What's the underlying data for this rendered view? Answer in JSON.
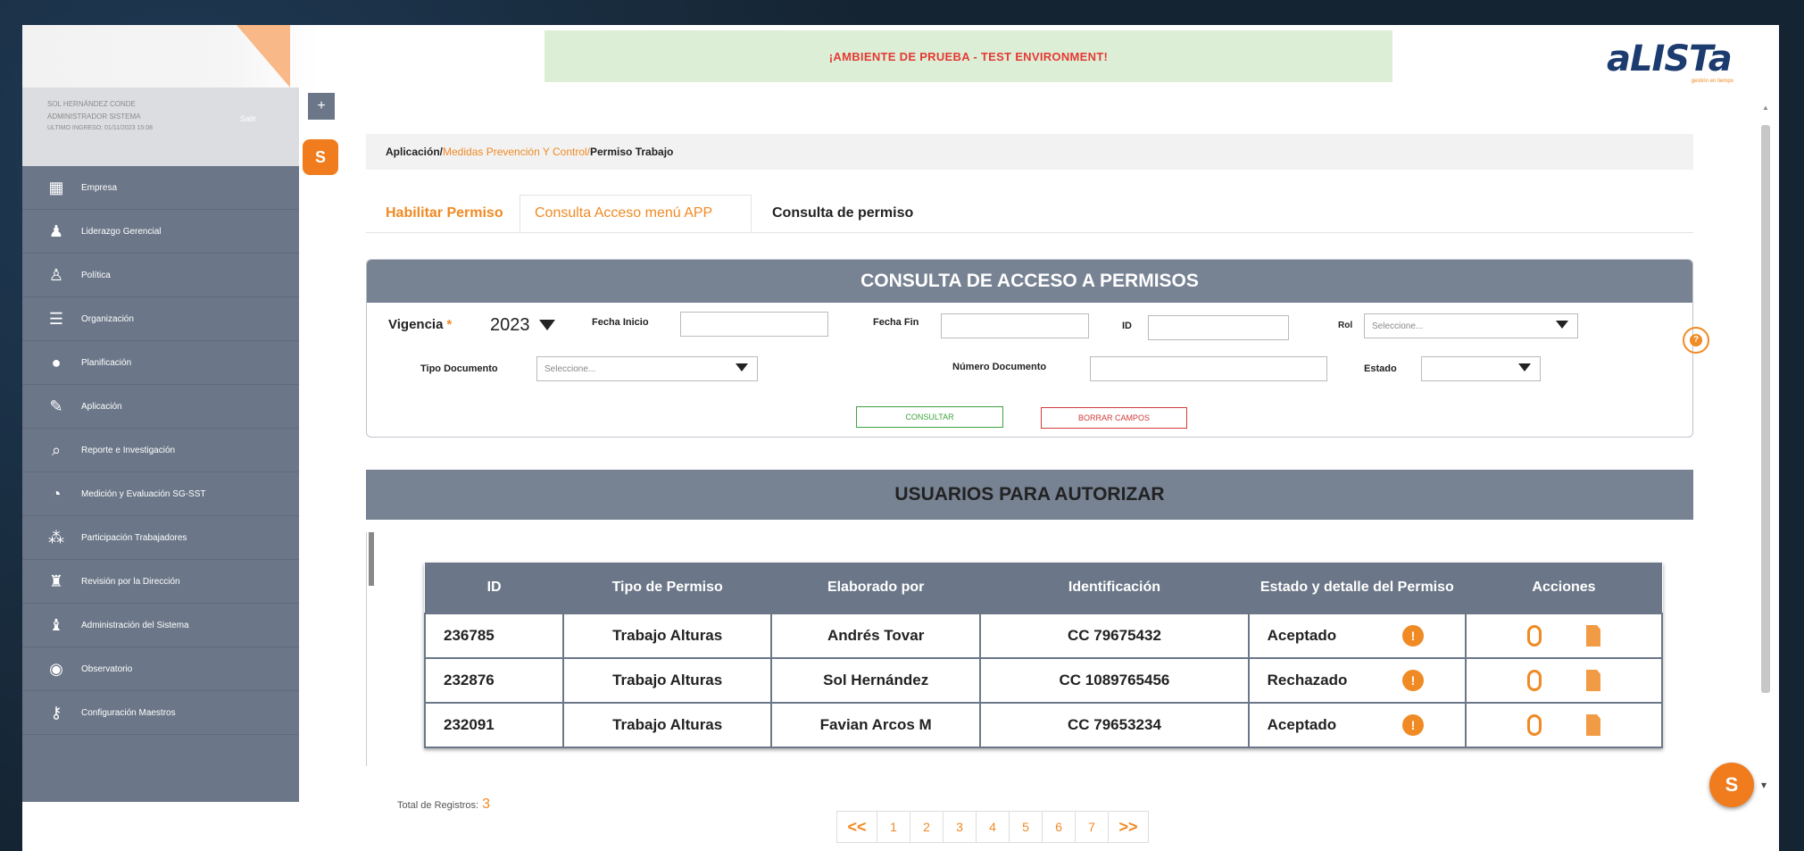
{
  "env_banner": "¡AMBIENTE DE PRUEBA - TEST ENVIRONMENT!",
  "logo": {
    "text": "aLISTa",
    "sub": "gestión en tiempo"
  },
  "user": {
    "name": "SOL HERNÁNDEZ CONDE",
    "role": "ADMINISTRADOR SISTEMA",
    "last_login": "ULTIMO INGRESO: 01/11/2023 15:08",
    "logout": "Salir"
  },
  "sidebar": {
    "items": [
      {
        "label": "Empresa",
        "icon": "building-icon"
      },
      {
        "label": "Liderazgo Gerencial",
        "icon": "team-icon"
      },
      {
        "label": "Política",
        "icon": "person-icon"
      },
      {
        "label": "Organización",
        "icon": "list-icon"
      },
      {
        "label": "Planificación",
        "icon": "lightbulb-icon"
      },
      {
        "label": "Aplicación",
        "icon": "pencil-icon"
      },
      {
        "label": "Reporte e Investigación",
        "icon": "magnifier-icon"
      },
      {
        "label": "Medición y Evaluación SG-SST",
        "icon": "pie-chart-icon"
      },
      {
        "label": "Participación Trabajadores",
        "icon": "people-icon"
      },
      {
        "label": "Revisión por la Dirección",
        "icon": "reviewer-icon"
      },
      {
        "label": "Administración del Sistema",
        "icon": "admin-icon"
      },
      {
        "label": "Observatorio",
        "icon": "globe-icon"
      },
      {
        "label": "Configuración Maestros",
        "icon": "key-icon"
      }
    ]
  },
  "breadcrumb": {
    "root": "Aplicación/",
    "middle": "Medidas Prevención Y Control/",
    "current": "Permiso Trabajo"
  },
  "tabs": [
    "Habilitar Permiso",
    "Consulta Acceso menú APP",
    "Consulta de permiso"
  ],
  "search_panel": {
    "title": "CONSULTA DE ACCESO A PERMISOS",
    "vigencia_label": "Vigencia",
    "vigencia_value": "2023",
    "fecha_inicio_label": "Fecha Inicio",
    "fecha_fin_label": "Fecha Fin",
    "id_label": "ID",
    "rol_label": "Rol",
    "rol_placeholder": "Seleccione...",
    "tipo_doc_label": "Tipo Documento",
    "tipo_doc_placeholder": "Seleccione...",
    "numero_doc_label": "Número Documento",
    "estado_label": "Estado",
    "consultar_label": "CONSULTAR",
    "borrar_label": "BORRAR CAMPOS"
  },
  "users_panel": {
    "title": "USUARIOS PARA AUTORIZAR"
  },
  "table": {
    "headers": [
      "ID",
      "Tipo de Permiso",
      "Elaborado por",
      "Identificación",
      "Estado y detalle del Permiso",
      "Acciones"
    ],
    "rows": [
      {
        "id": "236785",
        "tipo": "Trabajo Alturas",
        "elaborado": "Andrés Tovar",
        "identificacion": "CC 79675432",
        "estado": "Aceptado"
      },
      {
        "id": "232876",
        "tipo": "Trabajo Alturas",
        "elaborado": "Sol Hernández",
        "identificacion": "CC 1089765456",
        "estado": "Rechazado"
      },
      {
        "id": "232091",
        "tipo": "Trabajo Alturas",
        "elaborado": "Favian Arcos M",
        "identificacion": "CC 79653234",
        "estado": "Aceptado"
      }
    ]
  },
  "total": {
    "label": "Total de Registros:",
    "value": "3"
  },
  "pager": {
    "first": "<<",
    "pages": [
      "1",
      "2",
      "3",
      "4",
      "5",
      "6",
      "7"
    ],
    "last": ">>"
  },
  "colors": {
    "accent": "#f08a24",
    "sidebar": "#6b7788",
    "header": "#778293"
  }
}
